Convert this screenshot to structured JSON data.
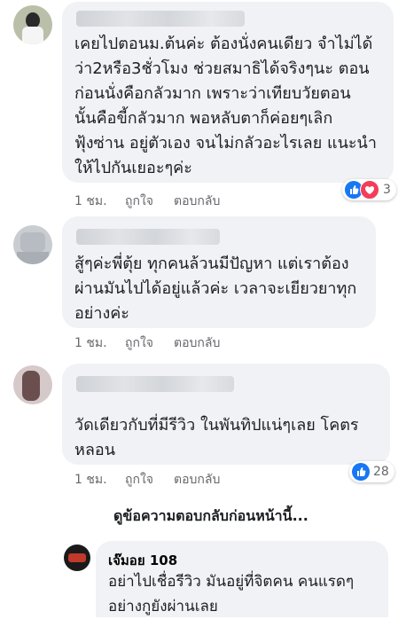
{
  "comments": [
    {
      "text_lines": [
        "เคยไปตอนม.ต้นค่ะ ต้องนั่งคนเดียว จำไม่ได้",
        "ว่า2หรือ3ชั่วโมง ช่วยสมาธิได้จริงๆนะ ตอน",
        "ก่อนนั่งคือกลัวมาก เพราะว่าเทียบวัยตอน",
        "นั้นคือขี้กลัวมาก พอหลับตาก็ค่อยๆเลิก",
        "ฟุ้งซ่าน อยู่ตัวเอง จนไม่กลัวอะไรเลย แนะนำ",
        "ให้ไปกันเยอะๆค่ะ"
      ],
      "time": "1 ชม.",
      "like_label": "ถูกใจ",
      "reply_label": "ตอบกลับ",
      "reaction_count": "3"
    },
    {
      "text_lines": [
        "สู้ๆค่ะพี่ตุ้ย ทุกคนล้วนมีปัญหา แต่เราต้อง",
        "ผ่านมันไปได้อยู่แล้วค่ะ เวลาจะเยียวยาทุก",
        "อย่างค่ะ"
      ],
      "time": "1 ชม.",
      "like_label": "ถูกใจ",
      "reply_label": "ตอบกลับ"
    },
    {
      "text_lines": [
        "วัดเดียวกับที่มีรีวิว ในพันทิปแน่ๆเลย  โคตร",
        "หลอน"
      ],
      "time": "1 ชม.",
      "like_label": "ถูกใจ",
      "reply_label": "ตอบกลับ",
      "reaction_count": "28"
    }
  ],
  "view_previous_replies": "ดูข้อความตอบกลับก่อนหน้านี้...",
  "reply": {
    "name": "เจ๊มอย 108",
    "text_lines": [
      "อย่าไปเชื่อรีวิว มันอยู่ที่จิตคน คนแรดๆ",
      "อย่างกูยังผ่านเลย"
    ]
  },
  "colors": {
    "bubble": "#f0f2f5",
    "like_blue": "#1877f2",
    "love_red": "#f33e58",
    "meta_text": "#65676b"
  },
  "icons": [
    "like-icon",
    "love-icon"
  ]
}
